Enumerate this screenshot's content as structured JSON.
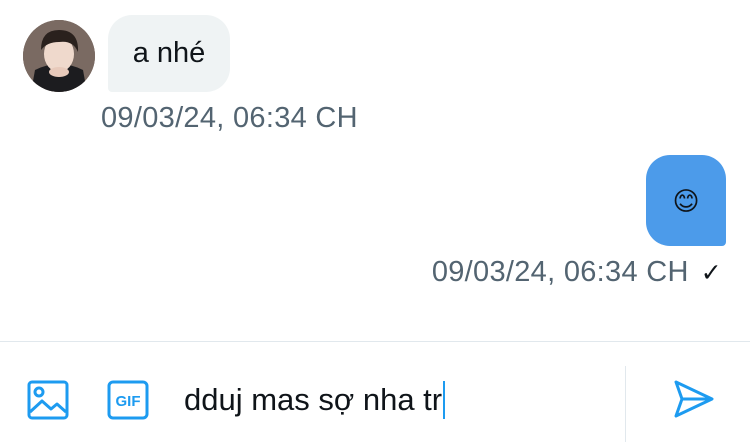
{
  "conversation": {
    "incoming": {
      "text": "a nhé",
      "timestamp": "09/03/24, 06:34 CH"
    },
    "outgoing": {
      "emoji": "😊",
      "timestamp": "09/03/24, 06:34 CH",
      "status_glyph": "✓"
    }
  },
  "composer": {
    "text": "dduj mas sợ nha tr",
    "gif_label": "GIF",
    "icons": {
      "media": "image-icon",
      "gif": "gif-icon",
      "send": "send-icon"
    }
  },
  "colors": {
    "accent": "#1d9bf0",
    "outgoing_bubble": "#4c9bea",
    "incoming_bubble": "#eff3f4",
    "timestamp": "#536471"
  }
}
